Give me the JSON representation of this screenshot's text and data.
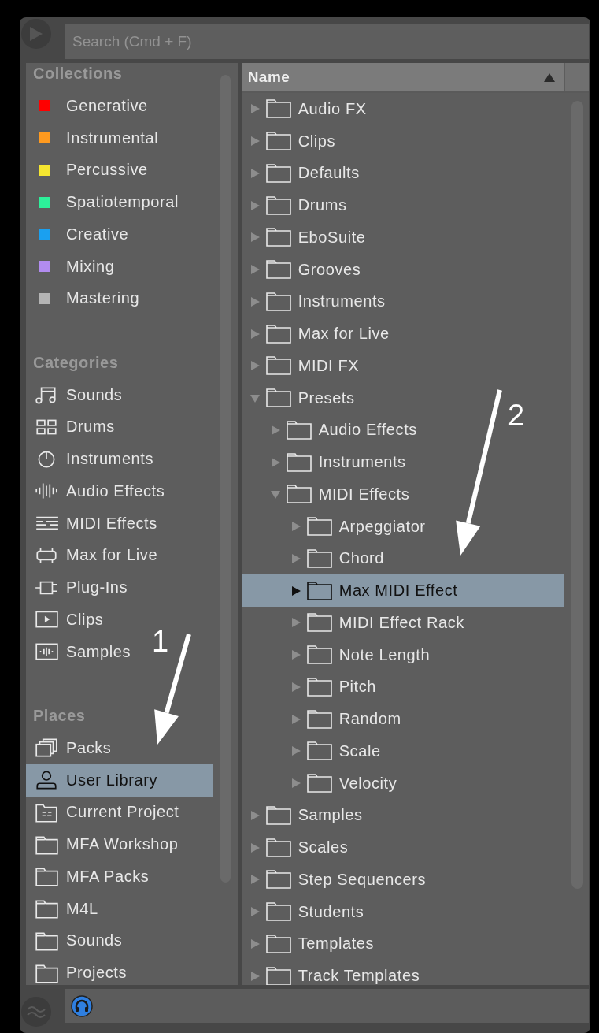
{
  "search": {
    "placeholder": "Search (Cmd + F)"
  },
  "sidebar": {
    "sections": [
      {
        "title": "Collections",
        "items": [
          {
            "label": "Generative",
            "kind": "swatch",
            "color": "#ff0000",
            "selected": false
          },
          {
            "label": "Instrumental",
            "kind": "swatch",
            "color": "#ff9a1f",
            "selected": false
          },
          {
            "label": "Percussive",
            "kind": "swatch",
            "color": "#f5e630",
            "selected": false
          },
          {
            "label": "Spatiotemporal",
            "kind": "swatch",
            "color": "#2df09a",
            "selected": false
          },
          {
            "label": "Creative",
            "kind": "swatch",
            "color": "#1aa0f0",
            "selected": false
          },
          {
            "label": "Mixing",
            "kind": "swatch",
            "color": "#b28cf0",
            "selected": false
          },
          {
            "label": "Mastering",
            "kind": "swatch",
            "color": "#b4b4b4",
            "selected": false
          }
        ]
      },
      {
        "title": "Categories",
        "items": [
          {
            "label": "Sounds",
            "kind": "note",
            "selected": false
          },
          {
            "label": "Drums",
            "kind": "pads",
            "selected": false
          },
          {
            "label": "Instruments",
            "kind": "knob",
            "selected": false
          },
          {
            "label": "Audio Effects",
            "kind": "wave",
            "selected": false
          },
          {
            "label": "MIDI Effects",
            "kind": "midi",
            "selected": false
          },
          {
            "label": "Max for Live",
            "kind": "device",
            "selected": false
          },
          {
            "label": "Plug-Ins",
            "kind": "plug",
            "selected": false
          },
          {
            "label": "Clips",
            "kind": "clip",
            "selected": false
          },
          {
            "label": "Samples",
            "kind": "sample",
            "selected": false
          }
        ]
      },
      {
        "title": "Places",
        "items": [
          {
            "label": "Packs",
            "kind": "packs",
            "selected": false
          },
          {
            "label": "User Library",
            "kind": "user",
            "selected": true
          },
          {
            "label": "Current Project",
            "kind": "project",
            "selected": false
          },
          {
            "label": "MFA Workshop",
            "kind": "folder",
            "selected": false
          },
          {
            "label": "MFA Packs",
            "kind": "folder",
            "selected": false
          },
          {
            "label": "M4L",
            "kind": "folder",
            "selected": false
          },
          {
            "label": "Sounds",
            "kind": "folder",
            "selected": false
          },
          {
            "label": "Projects",
            "kind": "folder",
            "selected": false
          }
        ]
      }
    ]
  },
  "tree": {
    "column": "Name",
    "items": [
      {
        "label": "Audio FX",
        "expanded": false,
        "selected": false
      },
      {
        "label": "Clips",
        "expanded": false,
        "selected": false
      },
      {
        "label": "Defaults",
        "expanded": false,
        "selected": false
      },
      {
        "label": "Drums",
        "expanded": false,
        "selected": false
      },
      {
        "label": "EboSuite",
        "expanded": false,
        "selected": false
      },
      {
        "label": "Grooves",
        "expanded": false,
        "selected": false
      },
      {
        "label": "Instruments",
        "expanded": false,
        "selected": false
      },
      {
        "label": "Max for Live",
        "expanded": false,
        "selected": false
      },
      {
        "label": "MIDI FX",
        "expanded": false,
        "selected": false
      },
      {
        "label": "Presets",
        "expanded": true,
        "selected": false,
        "children": [
          {
            "label": "Audio Effects",
            "expanded": false,
            "selected": false
          },
          {
            "label": "Instruments",
            "expanded": false,
            "selected": false
          },
          {
            "label": "MIDI Effects",
            "expanded": true,
            "selected": false,
            "children": [
              {
                "label": "Arpeggiator",
                "expanded": false,
                "selected": false
              },
              {
                "label": "Chord",
                "expanded": false,
                "selected": false
              },
              {
                "label": "Max MIDI Effect",
                "expanded": false,
                "selected": true
              },
              {
                "label": "MIDI Effect Rack",
                "expanded": false,
                "selected": false
              },
              {
                "label": "Note Length",
                "expanded": false,
                "selected": false
              },
              {
                "label": "Pitch",
                "expanded": false,
                "selected": false
              },
              {
                "label": "Random",
                "expanded": false,
                "selected": false
              },
              {
                "label": "Scale",
                "expanded": false,
                "selected": false
              },
              {
                "label": "Velocity",
                "expanded": false,
                "selected": false
              }
            ]
          }
        ]
      },
      {
        "label": "Samples",
        "expanded": false,
        "selected": false
      },
      {
        "label": "Scales",
        "expanded": false,
        "selected": false
      },
      {
        "label": "Step Sequencers",
        "expanded": false,
        "selected": false
      },
      {
        "label": "Students",
        "expanded": false,
        "selected": false
      },
      {
        "label": "Templates",
        "expanded": false,
        "selected": false
      },
      {
        "label": "Track Templates",
        "expanded": false,
        "selected": false
      }
    ]
  },
  "annotations": [
    {
      "label": "1"
    },
    {
      "label": "2"
    }
  ]
}
